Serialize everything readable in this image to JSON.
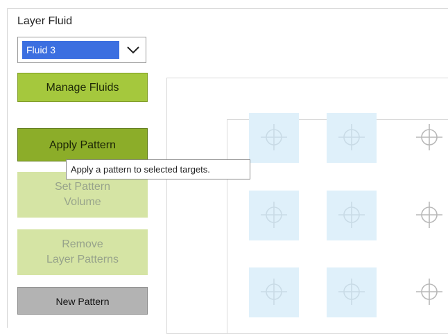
{
  "layer_fluid": {
    "label": "Layer Fluid",
    "selected_value": "Fluid 3",
    "selected_color": "#3c6fe0"
  },
  "buttons": {
    "manage_fluids": "Manage Fluids",
    "apply_pattern": "Apply Pattern",
    "set_pattern_volume": "Set Pattern\nVolume",
    "remove_layer_patterns": "Remove\nLayer Patterns",
    "new_pattern": "New Pattern"
  },
  "tooltip": {
    "text": "Apply a pattern to selected targets."
  },
  "grid": {
    "rows": 3,
    "cols": 3,
    "targets": [
      {
        "row": 1,
        "col": 1,
        "selected": true
      },
      {
        "row": 1,
        "col": 2,
        "selected": true
      },
      {
        "row": 1,
        "col": 3,
        "selected": false
      },
      {
        "row": 2,
        "col": 1,
        "selected": true
      },
      {
        "row": 2,
        "col": 2,
        "selected": true
      },
      {
        "row": 2,
        "col": 3,
        "selected": false
      },
      {
        "row": 3,
        "col": 1,
        "selected": true
      },
      {
        "row": 3,
        "col": 2,
        "selected": true
      },
      {
        "row": 3,
        "col": 3,
        "selected": false
      }
    ]
  },
  "colors": {
    "primary_green": "#8cad29",
    "secondary_green": "#a5c83d",
    "disabled_green": "#d5e4a4",
    "selection_blue": "#dff0fa"
  }
}
